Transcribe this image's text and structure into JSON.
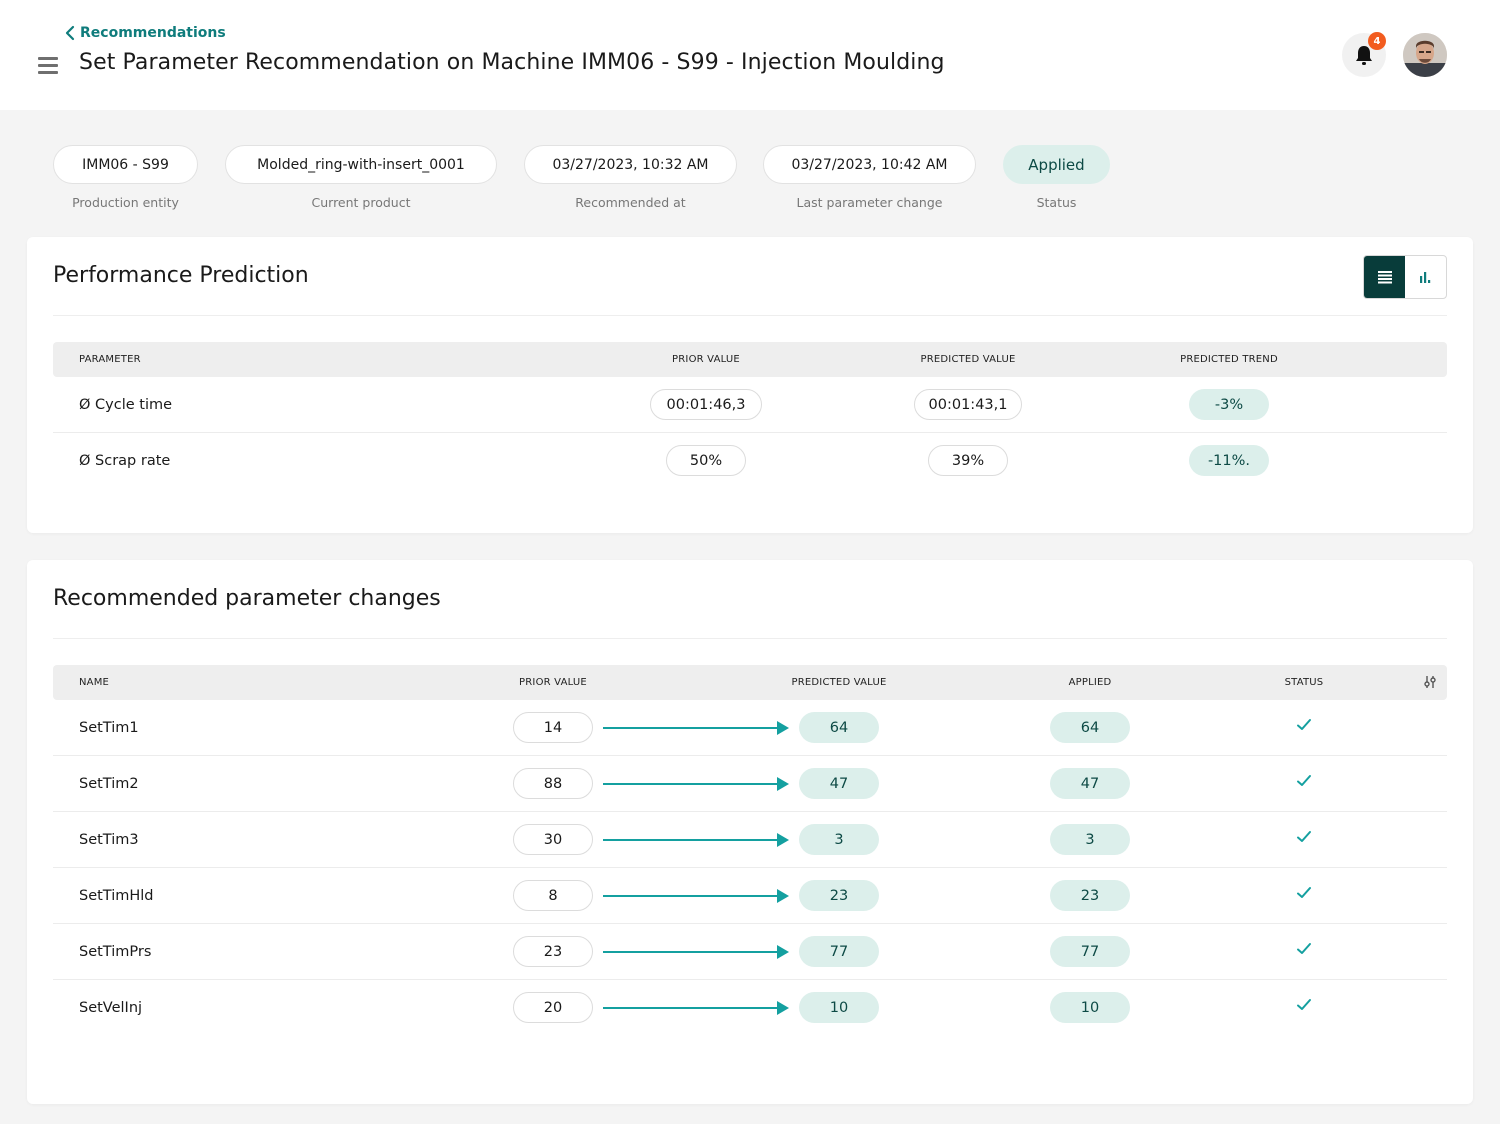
{
  "header": {
    "back_label": "Recommendations",
    "title": "Set Parameter Recommendation on Machine IMM06 - S99 - Injection Moulding",
    "notification_count": "4"
  },
  "info": [
    {
      "value": "IMM06 - S99",
      "label": "Production entity"
    },
    {
      "value": "Molded_ring-with-insert_0001",
      "label": "Current product"
    },
    {
      "value": "03/27/2023, 10:32 AM",
      "label": "Recommended at"
    },
    {
      "value": "03/27/2023, 10:42 AM",
      "label": "Last parameter change"
    },
    {
      "value": "Applied",
      "label": "Status"
    }
  ],
  "performance": {
    "title": "Performance Prediction",
    "columns": {
      "parameter": "PARAMETER",
      "prior": "PRIOR VALUE",
      "predicted": "PREDICTED VALUE",
      "trend": "PREDICTED TREND"
    },
    "rows": [
      {
        "parameter": "Ø Cycle time",
        "prior": "00:01:46,3",
        "predicted": "00:01:43,1",
        "trend": "-3%"
      },
      {
        "parameter": "Ø Scrap rate",
        "prior": "50%",
        "predicted": "39%",
        "trend": "-11%."
      }
    ]
  },
  "changes": {
    "title": "Recommended parameter changes",
    "columns": {
      "name": "NAME",
      "prior": "PRIOR VALUE",
      "predicted": "PREDICTED VALUE",
      "applied": "APPLIED",
      "status": "STATUS"
    },
    "rows": [
      {
        "name": "SetTim1",
        "prior": "14",
        "predicted": "64",
        "applied": "64"
      },
      {
        "name": "SetTim2",
        "prior": "88",
        "predicted": "47",
        "applied": "47"
      },
      {
        "name": "SetTim3",
        "prior": "30",
        "predicted": "3",
        "applied": "3"
      },
      {
        "name": "SetTimHld",
        "prior": "8",
        "predicted": "23",
        "applied": "23"
      },
      {
        "name": "SetTimPrs",
        "prior": "23",
        "predicted": "77",
        "applied": "77"
      },
      {
        "name": "SetVelInj",
        "prior": "20",
        "predicted": "10",
        "applied": "10"
      }
    ]
  },
  "colors": {
    "accent": "#0f7c7c",
    "teal_pill": "#dcefeb",
    "dark_toggle": "#083c3a",
    "badge": "#f25c1f"
  },
  "icons": {
    "back": "chevron-left-icon",
    "menu": "hamburger-menu-icon",
    "bell": "bell-icon",
    "list_view": "list-view-icon",
    "chart_view": "bar-chart-icon",
    "settings": "column-settings-icon",
    "status": "check-icon"
  }
}
